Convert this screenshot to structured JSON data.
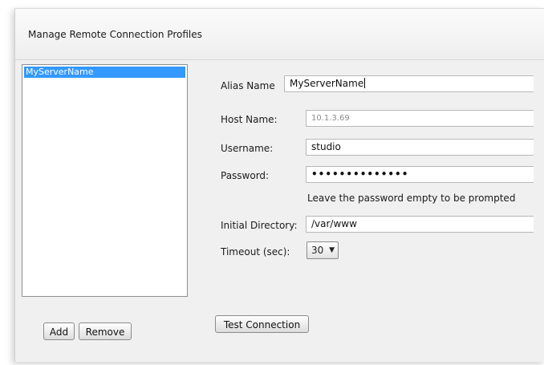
{
  "header": {
    "title": "Manage Remote Connection Profiles"
  },
  "profiles": {
    "items": [
      "MyServerName"
    ],
    "selected_index": 0
  },
  "list_buttons": {
    "add_label": "Add",
    "remove_label": "Remove"
  },
  "form": {
    "alias_label": "Alias Name",
    "alias_value": "MyServerName",
    "host_label": "Host Name:",
    "host_value": "10.1.3.69",
    "username_label": "Username:",
    "username_value": "studio",
    "password_label": "Password:",
    "password_value": "••••••••••••••",
    "password_hint": "Leave the password empty to be prompted",
    "directory_label": "Initial Directory:",
    "directory_value": "/var/www",
    "timeout_label": "Timeout (sec):",
    "timeout_value": "30",
    "test_connection_label": "Test Connection"
  },
  "colors": {
    "selection": "#3399ff",
    "panel": "#f0f0f0"
  },
  "icons": {
    "timeout_dropdown": "chevron-down-icon"
  }
}
